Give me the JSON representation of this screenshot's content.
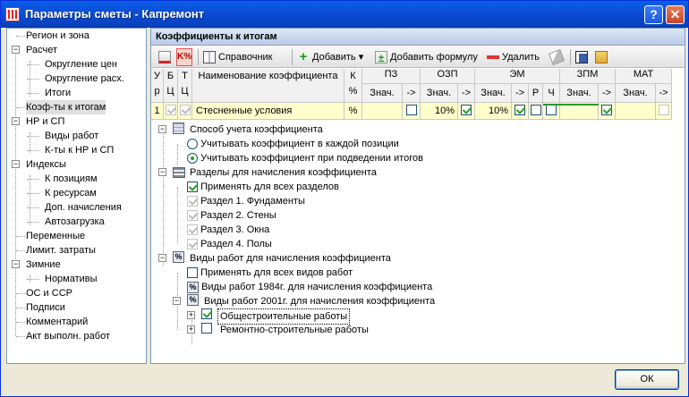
{
  "window": {
    "title": "Параметры сметы - Капремонт",
    "help_label": "?",
    "close_label": "✕"
  },
  "sidebar": {
    "items": [
      {
        "label": "Регион и зона"
      },
      {
        "label": "Расчет",
        "exp": "−"
      },
      {
        "label": "Округление цен"
      },
      {
        "label": "Округление расх."
      },
      {
        "label": "Итоги"
      },
      {
        "label": "Коэф-ты к итогам"
      },
      {
        "label": "НР и СП",
        "exp": "−"
      },
      {
        "label": "Виды работ"
      },
      {
        "label": "К-ты к НР и СП"
      },
      {
        "label": "Индексы",
        "exp": "−"
      },
      {
        "label": "К позициям"
      },
      {
        "label": "К ресурсам"
      },
      {
        "label": "Доп. начисления"
      },
      {
        "label": "Автозагрузка"
      },
      {
        "label": "Переменные"
      },
      {
        "label": "Лимит. затраты"
      },
      {
        "label": "Зимние",
        "exp": "−"
      },
      {
        "label": "Нормативы"
      },
      {
        "label": "ОС и ССР"
      },
      {
        "label": "Подписи"
      },
      {
        "label": "Комментарий"
      },
      {
        "label": "Акт выполн. работ"
      }
    ]
  },
  "panel": {
    "title": "Коэффициенты к итогам"
  },
  "toolbar": {
    "reference": "Справочник",
    "add": "Добавить",
    "add_dropdown": "▾",
    "add_formula": "Добавить формулу",
    "delete": "Удалить"
  },
  "grid": {
    "h_u": [
      "У",
      "р"
    ],
    "h_b": [
      "Б",
      "Ц"
    ],
    "h_t": [
      "Т",
      "Ц"
    ],
    "h_name": "Наименование коэффициента",
    "h_k": [
      "К",
      "%"
    ],
    "groups": [
      "ПЗ",
      "ОЗП",
      "ЭМ",
      "ЗПМ",
      "МАТ"
    ],
    "sub_value": "Знач.",
    "sub_arrow": "->",
    "sub_r": "Р",
    "sub_ch": "Ч",
    "row": {
      "num": "1",
      "name": "Стесненные условия",
      "pct": "%",
      "ozp": "10%",
      "em": "10%"
    }
  },
  "props": {
    "method_label": "Способ учета коэффициента",
    "radio1": "Учитывать коэффициент в каждой позиции",
    "radio2": "Учитывать коэффициент при подведении итогов",
    "sections_label": "Разделы для начисления коэффициента",
    "apply_all_sections": "Применять для всех разделов",
    "section1": "Раздел 1. Фундаменты",
    "section2": "Раздел 2. Стены",
    "section3": "Раздел 3. Окна",
    "section4": "Раздел 4. Полы",
    "worktypes_label": "Виды работ для начисления коэффициента",
    "apply_all_works": "Применять для всех видов работ",
    "works1984": "Виды работ 1984г. для начисления коэффициента",
    "works2001": "Виды работ 2001г. для начисления коэффициента",
    "general": "Общестроительные работы",
    "repair": "Ремонтно-строительные работы"
  },
  "footer": {
    "ok_label": "ОК"
  }
}
